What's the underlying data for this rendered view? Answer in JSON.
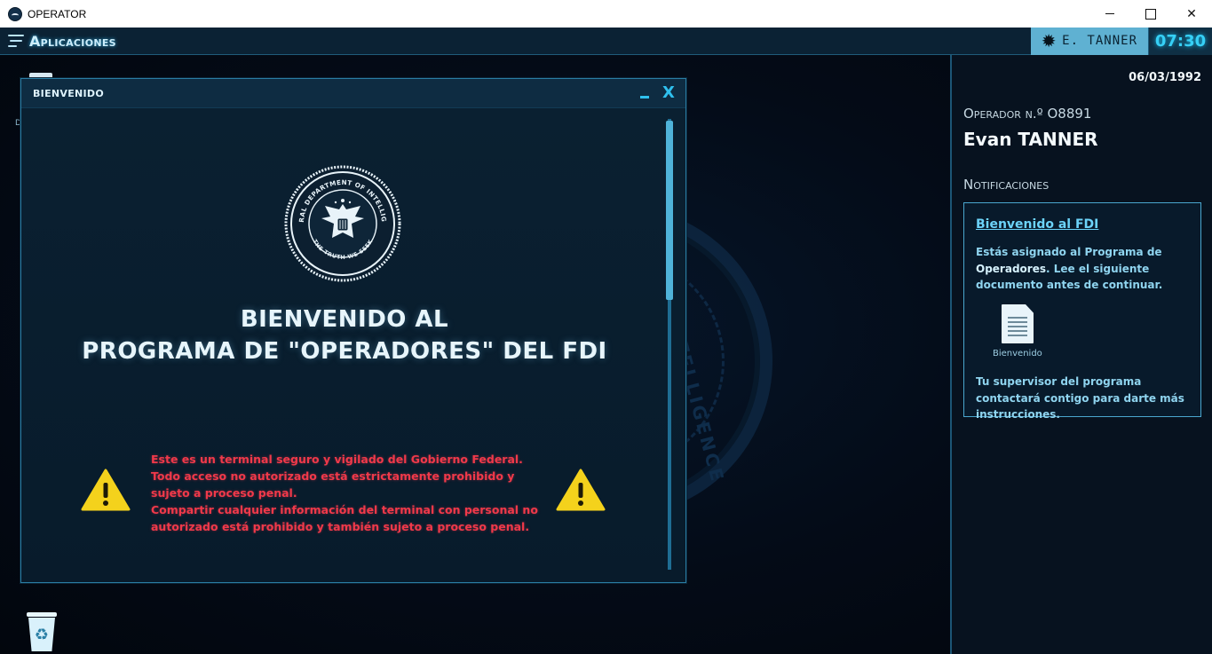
{
  "window": {
    "title": "OPERATOR",
    "minimize": "—",
    "maximize": "☐",
    "close": "✕"
  },
  "topbar": {
    "apps_label": "Aplicaciones",
    "user": "E. TANNER",
    "time": "07:30"
  },
  "desktop": {
    "doc_label": "D",
    "bg_seal_text": "INTELLIGENCE"
  },
  "welcome": {
    "title": "BIENVENIDO",
    "close_label": "X",
    "seal_top_text": "FEDERAL DEPARTMENT OF INTELLIGENCE",
    "seal_bottom_text": "THE TRUTH WE SEEK",
    "headline_1": "BIENVENIDO AL",
    "headline_2": "PROGRAMA DE \"OPERADORES\" DEL FDI",
    "warning_1": "Este es un terminal seguro y vigilado del Gobierno Federal.",
    "warning_2": "Todo acceso no autorizado está estrictamente prohibido y sujeto a proceso penal.",
    "warning_3": "Compartir cualquier información del terminal con personal no autorizado está prohibido y también sujeto a proceso penal."
  },
  "panel": {
    "date": "06/03/1992",
    "operator_label": "Operador n.º O8891",
    "operator_name": "Evan TANNER",
    "notifications_title": "Notificaciones",
    "notification": {
      "link": "Bienvenido al FDI",
      "body_1": "Estás asignado al Programa de ",
      "body_bold": "Operadores",
      "body_2": ". Lee el siguiente documento antes de continuar.",
      "doc_label": "Bienvenido",
      "footer": "Tu supervisor del programa contactará contigo para darte más instrucciones."
    }
  },
  "colors": {
    "accent": "#2fc0ee",
    "warning": "#f0394a",
    "warning_icon": "#f4d21c"
  }
}
